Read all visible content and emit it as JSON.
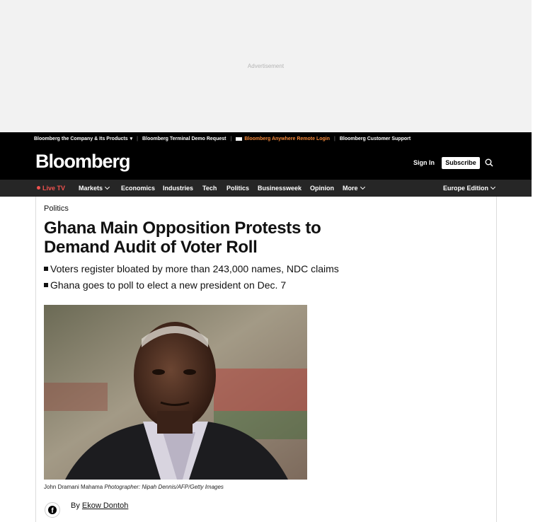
{
  "ad": {
    "label": "Advertisement"
  },
  "utility_bar": {
    "company": "Bloomberg the Company & Its Products",
    "company_caret": "▾",
    "separator": "|",
    "terminal_demo": "Bloomberg Terminal Demo Request",
    "anywhere_login": "Bloomberg Anywhere Remote Login",
    "customer_support": "Bloomberg Customer Support"
  },
  "masthead": {
    "logo": "Bloomberg",
    "sign_in": "Sign In",
    "subscribe": "Subscribe"
  },
  "nav": {
    "live_tv": "Live TV",
    "markets": "Markets",
    "economics": "Economics",
    "industries": "Industries",
    "tech": "Tech",
    "politics": "Politics",
    "businessweek": "Businessweek",
    "opinion": "Opinion",
    "more": "More",
    "edition": "Europe Edition"
  },
  "article": {
    "section": "Politics",
    "headline": "Ghana Main Opposition Protests to Demand Audit of Voter Roll",
    "bullets": [
      "Voters register bloated by more than 243,000 names, NDC claims",
      "Ghana goes to poll to elect a new president on Dec. 7"
    ],
    "caption_subject": "John Dramani Mahama",
    "caption_credit": "Photographer: Nipah Dennis/AFP/Getty Images",
    "byline_prefix": "By",
    "author": "Ekow Dontoh"
  },
  "colors": {
    "accent_orange": "#f7893a",
    "live_red": "#f0524f"
  }
}
